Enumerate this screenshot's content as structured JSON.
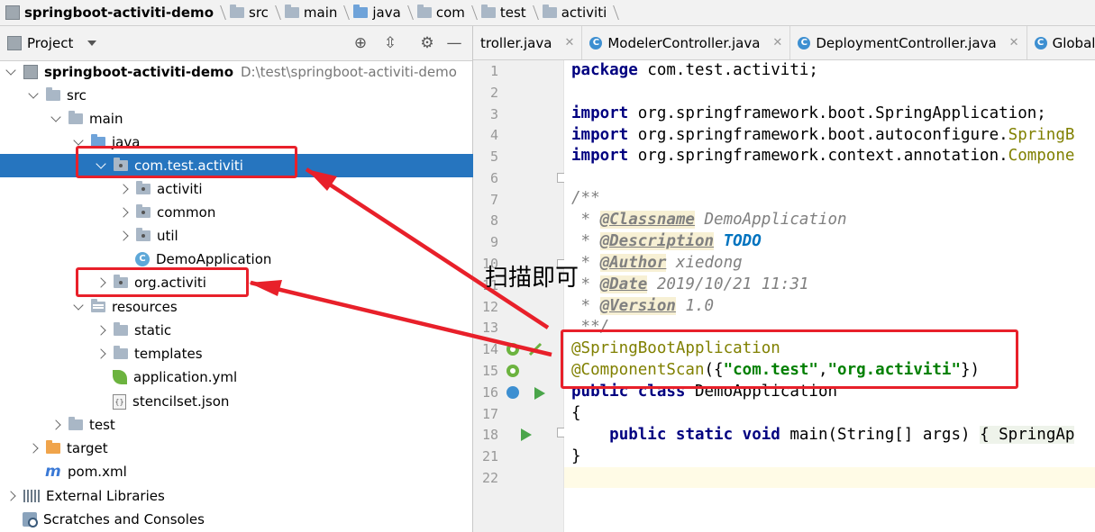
{
  "breadcrumb": [
    "springboot-activiti-demo",
    "src",
    "main",
    "java",
    "com",
    "test",
    "activiti"
  ],
  "project_panel": {
    "title": "Project",
    "tree": [
      {
        "label": "springboot-activiti-demo",
        "path": "D:\\test\\springboot-activiti-demo",
        "indent": 0,
        "arrow": "down",
        "icon": "project-icon",
        "bold": true
      },
      {
        "label": "src",
        "indent": 1,
        "arrow": "down",
        "icon": "folder-icon"
      },
      {
        "label": "main",
        "indent": 2,
        "arrow": "down",
        "icon": "folder-icon"
      },
      {
        "label": "java",
        "indent": 3,
        "arrow": "down",
        "icon": "source-folder-icon"
      },
      {
        "label": "com.test.activiti",
        "indent": 4,
        "arrow": "down",
        "icon": "package-icon",
        "selected": true
      },
      {
        "label": "activiti",
        "indent": 5,
        "arrow": "right",
        "icon": "package-icon"
      },
      {
        "label": "common",
        "indent": 5,
        "arrow": "right",
        "icon": "package-icon"
      },
      {
        "label": "util",
        "indent": 5,
        "arrow": "right",
        "icon": "package-icon"
      },
      {
        "label": "DemoApplication",
        "indent": 5,
        "arrow": "none",
        "icon": "spring-class-icon"
      },
      {
        "label": "org.activiti",
        "indent": 4,
        "arrow": "right",
        "icon": "package-icon"
      },
      {
        "label": "resources",
        "indent": 3,
        "arrow": "down",
        "icon": "resources-folder-icon"
      },
      {
        "label": "static",
        "indent": 4,
        "arrow": "right",
        "icon": "folder-icon"
      },
      {
        "label": "templates",
        "indent": 4,
        "arrow": "right",
        "icon": "folder-icon"
      },
      {
        "label": "application.yml",
        "indent": 4,
        "arrow": "none",
        "icon": "spring-leaf-icon"
      },
      {
        "label": "stencilset.json",
        "indent": 4,
        "arrow": "none",
        "icon": "json-file-icon"
      },
      {
        "label": "test",
        "indent": 2,
        "arrow": "right",
        "icon": "folder-icon"
      },
      {
        "label": "target",
        "indent": 1,
        "arrow": "right",
        "icon": "orange-folder-icon"
      },
      {
        "label": "pom.xml",
        "indent": 1,
        "arrow": "none",
        "icon": "maven-icon"
      },
      {
        "label": "External Libraries",
        "indent": 0,
        "arrow": "right",
        "icon": "libraries-icon"
      },
      {
        "label": "Scratches and Consoles",
        "indent": 0,
        "arrow": "none",
        "icon": "scratches-icon"
      }
    ]
  },
  "tabs": [
    {
      "label": "troller.java",
      "icon": false
    },
    {
      "label": "ModelerController.java",
      "icon": true
    },
    {
      "label": "DeploymentController.java",
      "icon": true
    },
    {
      "label": "GlobalExc",
      "icon": true
    }
  ],
  "line_numbers": [
    "1",
    "2",
    "3",
    "4",
    "5",
    "6",
    "7",
    "8",
    "9",
    "10",
    "11",
    "12",
    "13",
    "14",
    "15",
    "16",
    "17",
    "18",
    "21",
    "22"
  ],
  "code": {
    "l1_kw": "package",
    "l1_rest": " com.test.activiti;",
    "l3_kw": "import",
    "l3_rest": " org.springframework.boot.SpringApplication;",
    "l4_kw": "import",
    "l4_rest": " org.springframework.boot.autoconfigure.",
    "l4_ann": "SpringB",
    "l5_kw": "import",
    "l5_rest": " org.springframework.context.annotation.",
    "l5_ann": "Compone",
    "l7": "/**",
    "l8_pre": " * ",
    "l8_tag": "@Classname",
    "l8_rest": " DemoApplication",
    "l9_pre": " * ",
    "l9_tag": "@Description",
    "l9_todo": " TODO",
    "l10_pre": " * ",
    "l10_tag": "@Author",
    "l10_rest": " xiedong",
    "l11_pre": " * ",
    "l11_tag": "@Date",
    "l11_rest": " 2019/10/21 11:31",
    "l12_pre": " * ",
    "l12_tag": "@Version",
    "l12_rest": " 1.0",
    "l13": " **/",
    "l14": "@SpringBootApplication",
    "l15_ann": "@ComponentScan",
    "l15_p1": "({",
    "l15_s1": "\"com.test\"",
    "l15_c": ",",
    "l15_s2": "\"org.activiti\"",
    "l15_p2": "})",
    "l16_kw": "public class",
    "l16_rest": " DemoApplication",
    "l17": "{",
    "l18_kw": "public static void",
    "l18_rest": " main(String[] args) ",
    "l18_fold": "{ SpringAp",
    "l21": "}"
  },
  "annotation_label": "扫描即可",
  "colors": {
    "selection": "#2675bf",
    "highlight_box": "#e8202a",
    "arrow": "#e8202a"
  }
}
